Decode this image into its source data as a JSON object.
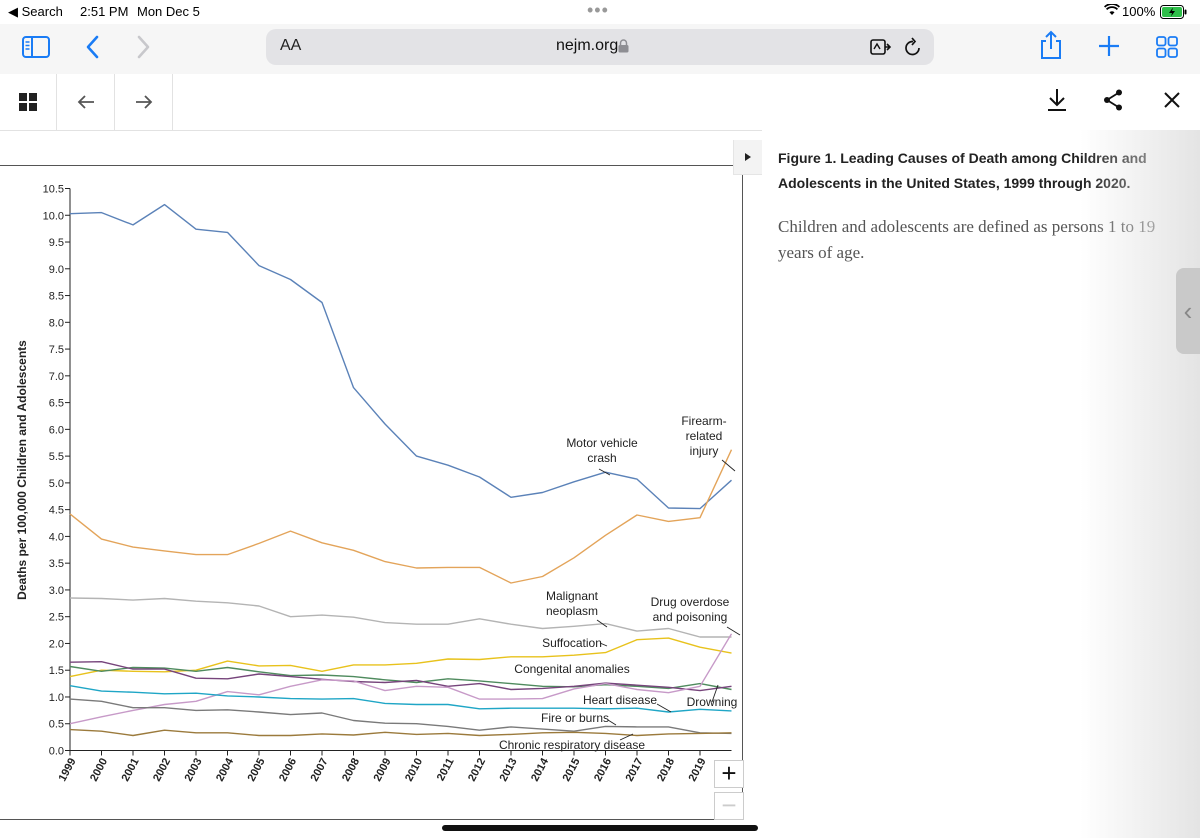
{
  "status_bar": {
    "back_label": "◀ Search",
    "time": "2:51 PM",
    "date": "Mon Dec 5",
    "battery": "100%"
  },
  "browser": {
    "text_size_label": "AA",
    "url": "nejm.org"
  },
  "figure": {
    "title": "Figure 1. Leading Causes of Death among Children and Adolescents in the United States, 1999 through 2020.",
    "description": "Children and adolescents are defined as persons 1 to 19 years of age."
  },
  "chart_data": {
    "type": "line",
    "ylabel": "Deaths per 100,000 Children and Adolescents",
    "ylim": [
      0,
      10.5
    ],
    "yticks": [
      "0.0",
      "0.5",
      "1.0",
      "1.5",
      "2.0",
      "2.5",
      "3.0",
      "3.5",
      "4.0",
      "4.5",
      "5.0",
      "5.5",
      "6.0",
      "6.5",
      "7.0",
      "7.5",
      "8.0",
      "8.5",
      "9.0",
      "9.5",
      "10.0",
      "10.5"
    ],
    "x": [
      "1999",
      "2000",
      "2001",
      "2002",
      "2003",
      "2004",
      "2005",
      "2006",
      "2007",
      "2008",
      "2009",
      "2010",
      "2011",
      "2012",
      "2013",
      "2014",
      "2015",
      "2016",
      "2017",
      "2018",
      "2019",
      "2020"
    ],
    "xticks": [
      "1999",
      "2000",
      "2001",
      "2002",
      "2003",
      "2004",
      "2005",
      "2006",
      "2007",
      "2008",
      "2009",
      "2010",
      "2011",
      "2012",
      "2013",
      "2014",
      "2015",
      "2016",
      "2017",
      "2018",
      "2019"
    ],
    "grid": false,
    "series": [
      {
        "name": "Motor vehicle crash",
        "color": "#5b82b8",
        "values": [
          10.03,
          10.05,
          9.82,
          10.2,
          9.74,
          9.68,
          9.06,
          8.8,
          8.37,
          6.78,
          6.1,
          5.5,
          5.33,
          5.11,
          4.73,
          4.82,
          5.02,
          5.2,
          5.07,
          4.53,
          4.52,
          5.05
        ]
      },
      {
        "name": "Firearm-related injury",
        "color": "#e3a45a",
        "values": [
          4.42,
          3.95,
          3.8,
          3.73,
          3.66,
          3.66,
          3.87,
          4.1,
          3.88,
          3.74,
          3.53,
          3.41,
          3.42,
          3.42,
          3.13,
          3.25,
          3.6,
          4.02,
          4.4,
          4.28,
          4.35,
          5.62
        ]
      },
      {
        "name": "Malignant neoplasm",
        "color": "#b4b4b4",
        "values": [
          2.85,
          2.84,
          2.81,
          2.84,
          2.79,
          2.76,
          2.7,
          2.5,
          2.53,
          2.49,
          2.39,
          2.36,
          2.36,
          2.46,
          2.36,
          2.28,
          2.32,
          2.37,
          2.23,
          2.28,
          2.12,
          2.12
        ]
      },
      {
        "name": "Suffocation",
        "color": "#e8c21c",
        "values": [
          1.38,
          1.5,
          1.48,
          1.47,
          1.5,
          1.67,
          1.58,
          1.59,
          1.48,
          1.6,
          1.6,
          1.63,
          1.71,
          1.7,
          1.75,
          1.75,
          1.78,
          1.83,
          2.07,
          2.1,
          1.93,
          1.82
        ]
      },
      {
        "name": "Congenital anomalies",
        "color": "#4f8b5e",
        "values": [
          1.57,
          1.48,
          1.55,
          1.54,
          1.48,
          1.55,
          1.47,
          1.4,
          1.41,
          1.38,
          1.32,
          1.27,
          1.34,
          1.3,
          1.25,
          1.2,
          1.19,
          1.23,
          1.2,
          1.16,
          1.25,
          1.14
        ]
      },
      {
        "name": "Heart disease",
        "color": "#76447b",
        "values": [
          1.65,
          1.66,
          1.52,
          1.52,
          1.35,
          1.34,
          1.43,
          1.38,
          1.33,
          1.29,
          1.27,
          1.31,
          1.2,
          1.25,
          1.14,
          1.16,
          1.2,
          1.26,
          1.22,
          1.18,
          1.12,
          1.2
        ]
      },
      {
        "name": "Drowning",
        "color": "#c79ac8",
        "values": [
          0.5,
          0.63,
          0.75,
          0.86,
          0.92,
          1.1,
          1.04,
          1.2,
          1.32,
          1.3,
          1.12,
          1.2,
          1.18,
          0.96,
          0.96,
          0.97,
          1.15,
          1.25,
          1.14,
          1.08,
          1.2,
          2.18
        ]
      },
      {
        "name": "Fire or burns",
        "color": "#1fa6c6",
        "values": [
          1.21,
          1.11,
          1.09,
          1.06,
          1.07,
          1.02,
          1.0,
          0.97,
          0.96,
          0.97,
          0.88,
          0.86,
          0.86,
          0.78,
          0.79,
          0.79,
          0.79,
          0.78,
          0.79,
          0.72,
          0.77,
          0.74
        ]
      },
      {
        "name": "Chronic respiratory disease",
        "color": "#7a7a7a",
        "values": [
          0.96,
          0.92,
          0.8,
          0.8,
          0.75,
          0.76,
          0.72,
          0.67,
          0.7,
          0.56,
          0.51,
          0.5,
          0.45,
          0.38,
          0.44,
          0.4,
          0.36,
          0.45,
          0.44,
          0.44,
          0.33,
          0.32
        ]
      },
      {
        "name": "",
        "color": "#9b7a3c",
        "values": [
          0.39,
          0.36,
          0.28,
          0.38,
          0.33,
          0.33,
          0.28,
          0.28,
          0.31,
          0.29,
          0.34,
          0.3,
          0.32,
          0.28,
          0.3,
          0.33,
          0.34,
          0.32,
          0.28,
          0.31,
          0.32,
          0.33
        ]
      }
    ],
    "annotations": [
      {
        "lines": [
          "Motor vehicle",
          "crash"
        ]
      },
      {
        "lines": [
          "Firearm-",
          "related",
          "injury"
        ]
      },
      {
        "lines": [
          "Malignant",
          "neoplasm"
        ]
      },
      {
        "lines": [
          "Drug overdose",
          "and poisoning"
        ]
      },
      {
        "lines": [
          "Suffocation"
        ]
      },
      {
        "lines": [
          "Congenital anomalies"
        ]
      },
      {
        "lines": [
          "Heart disease"
        ]
      },
      {
        "lines": [
          "Drowning"
        ]
      },
      {
        "lines": [
          "Fire or burns"
        ]
      },
      {
        "lines": [
          "Chronic respiratory disease"
        ]
      }
    ]
  },
  "zoom": {
    "in_label": "+",
    "out_label": "−"
  }
}
